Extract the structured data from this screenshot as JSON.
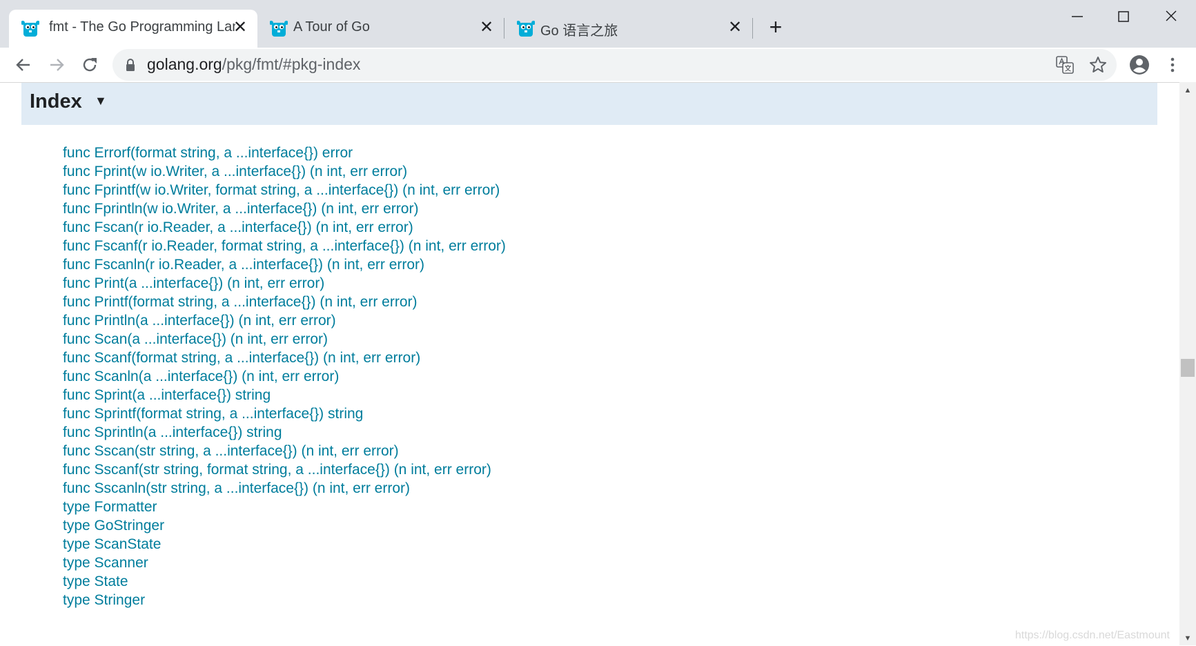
{
  "browser": {
    "tabs": [
      {
        "title": "fmt - The Go Programming Language",
        "active": true
      },
      {
        "title": "A Tour of Go",
        "active": false
      },
      {
        "title": "Go 语言之旅",
        "active": false
      }
    ],
    "tab_close_glyph": "✕",
    "new_tab_glyph": "+",
    "url": {
      "host": "golang.org",
      "path": "/pkg/fmt/#pkg-index"
    },
    "icons": {
      "favicon": "gopher-favicon-icon",
      "back": "back-arrow-icon",
      "forward": "forward-arrow-icon",
      "reload": "reload-icon",
      "lock": "lock-icon",
      "translate": "translate-icon",
      "bookmark": "star-icon",
      "profile": "account-icon",
      "menu": "kebab-menu-icon"
    }
  },
  "page": {
    "index_title": "Index",
    "index_toggle": "▼",
    "items": [
      "func Errorf(format string, a ...interface{}) error",
      "func Fprint(w io.Writer, a ...interface{}) (n int, err error)",
      "func Fprintf(w io.Writer, format string, a ...interface{}) (n int, err error)",
      "func Fprintln(w io.Writer, a ...interface{}) (n int, err error)",
      "func Fscan(r io.Reader, a ...interface{}) (n int, err error)",
      "func Fscanf(r io.Reader, format string, a ...interface{}) (n int, err error)",
      "func Fscanln(r io.Reader, a ...interface{}) (n int, err error)",
      "func Print(a ...interface{}) (n int, err error)",
      "func Printf(format string, a ...interface{}) (n int, err error)",
      "func Println(a ...interface{}) (n int, err error)",
      "func Scan(a ...interface{}) (n int, err error)",
      "func Scanf(format string, a ...interface{}) (n int, err error)",
      "func Scanln(a ...interface{}) (n int, err error)",
      "func Sprint(a ...interface{}) string",
      "func Sprintf(format string, a ...interface{}) string",
      "func Sprintln(a ...interface{}) string",
      "func Sscan(str string, a ...interface{}) (n int, err error)",
      "func Sscanf(str string, format string, a ...interface{}) (n int, err error)",
      "func Sscanln(str string, a ...interface{}) (n int, err error)",
      "type Formatter",
      "type GoStringer",
      "type ScanState",
      "type Scanner",
      "type State",
      "type Stringer"
    ],
    "watermark": "https://blog.csdn.net/Eastmount"
  },
  "colors": {
    "link": "#007d9c",
    "index_bar": "#e0ebf5",
    "tabstrip": "#dee1e6"
  }
}
